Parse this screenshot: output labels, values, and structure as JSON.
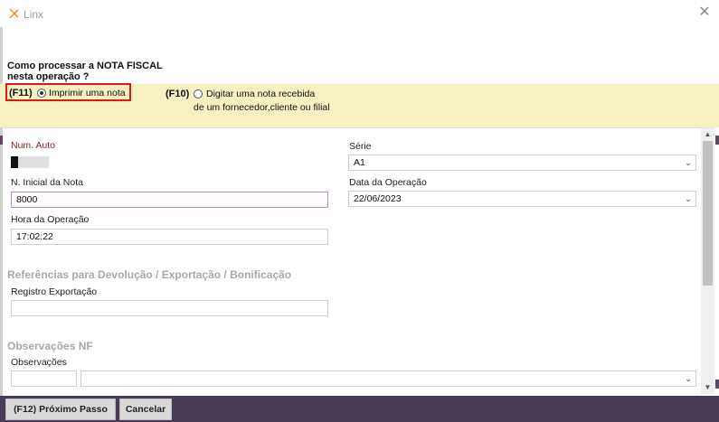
{
  "window": {
    "title": "Linx",
    "close_icon": "close-icon"
  },
  "question": {
    "line1": "Como processar a NOTA FISCAL",
    "line2": "nesta operação ?"
  },
  "options": {
    "f11": {
      "key": "(F11)",
      "label": "Imprimir uma nota",
      "selected": true
    },
    "f10": {
      "key": "(F10)",
      "label_line1": "Digitar uma nota recebida",
      "label_line2": "de um fornecedor,cliente ou filial",
      "selected": false
    }
  },
  "form": {
    "num_auto": {
      "label": "Num. Auto"
    },
    "serie": {
      "label": "Série",
      "value": "A1"
    },
    "n_inicial": {
      "label": "N. Inicial da Nota",
      "value": "8000"
    },
    "data_operacao": {
      "label": "Data da Operação",
      "value": "22/06/2023"
    },
    "hora_operacao": {
      "label": "Hora da Operação",
      "value": "17:02:22"
    },
    "section_refs": "Referências para Devolução / Exportação / Bonificação",
    "registro_exportacao": {
      "label": "Registro Exportação",
      "value": ""
    },
    "section_obs": "Observações NF",
    "observacoes": {
      "label": "Observações",
      "code": "",
      "value": ""
    }
  },
  "footer": {
    "next_label": "(F12) Próximo Passo",
    "cancel_label": "Cancelar"
  },
  "colors": {
    "highlight_band": "#f7f0c0",
    "highlight_border": "#e01818",
    "footer": "#4a3b55",
    "focus_border": "#b98ad8"
  }
}
